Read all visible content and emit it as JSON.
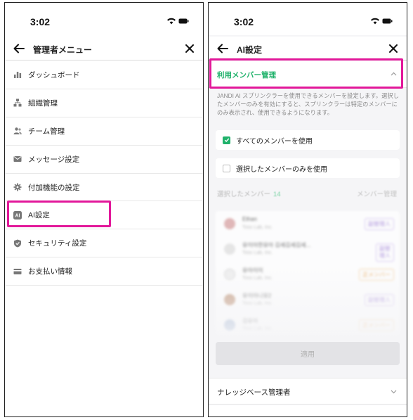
{
  "left": {
    "status_time": "3:02",
    "title": "管理者メニュー",
    "menu": [
      {
        "label": "ダッシュボード",
        "icon": "bar-chart-icon"
      },
      {
        "label": "組織管理",
        "icon": "org-tree-icon"
      },
      {
        "label": "チーム管理",
        "icon": "team-icon"
      },
      {
        "label": "メッセージ設定",
        "icon": "mail-icon"
      },
      {
        "label": "付加機能の設定",
        "icon": "gear-icon"
      },
      {
        "label": "AI設定",
        "icon": "ai-icon"
      },
      {
        "label": "セキュリティ設定",
        "icon": "shield-icon"
      },
      {
        "label": "お支払い情報",
        "icon": "card-icon"
      }
    ]
  },
  "right": {
    "status_time": "3:02",
    "title": "AI設定",
    "section1_label": "利用メンバー管理",
    "description": "JANDI AI スプリンクラーを使用できるメンバーを設定します。選択したメンバーのみを有効にすると、スプリンクラーは特定のメンバーにのみ表示され、使用できるようになります。",
    "option_all": "すべてのメンバーを使用",
    "option_selected": "選択したメンバーのみを使用",
    "selected_members_label": "選択したメンバー",
    "selected_members_count": "14",
    "member_management_label": "メンバー管理",
    "members": [
      {
        "name": "Ethan",
        "org": "Toss Lab, Inc.",
        "role": "副管理人",
        "role_type": "sub"
      },
      {
        "name": "유이아한유아 김세김세김세...",
        "org": "Toss Lab, Inc.",
        "role": "副管\n理人",
        "role_type": "sub"
      },
      {
        "name": "유아이이",
        "org": "Toss Lab, Inc.",
        "role": "正メンバー",
        "role_type": "main"
      },
      {
        "name": "유이아니유2",
        "org": "Toss Lab, Inc.",
        "role": "副管理人",
        "role_type": "sub"
      },
      {
        "name": "김유아",
        "org": "Toss Lab, Inc.",
        "role": "正メンバー",
        "role_type": "main"
      }
    ],
    "apply_label": "適用",
    "section2_label": "ナレッジベース管理者"
  },
  "colors": {
    "highlight": "#e2189a",
    "accent_green": "#20b26b"
  }
}
